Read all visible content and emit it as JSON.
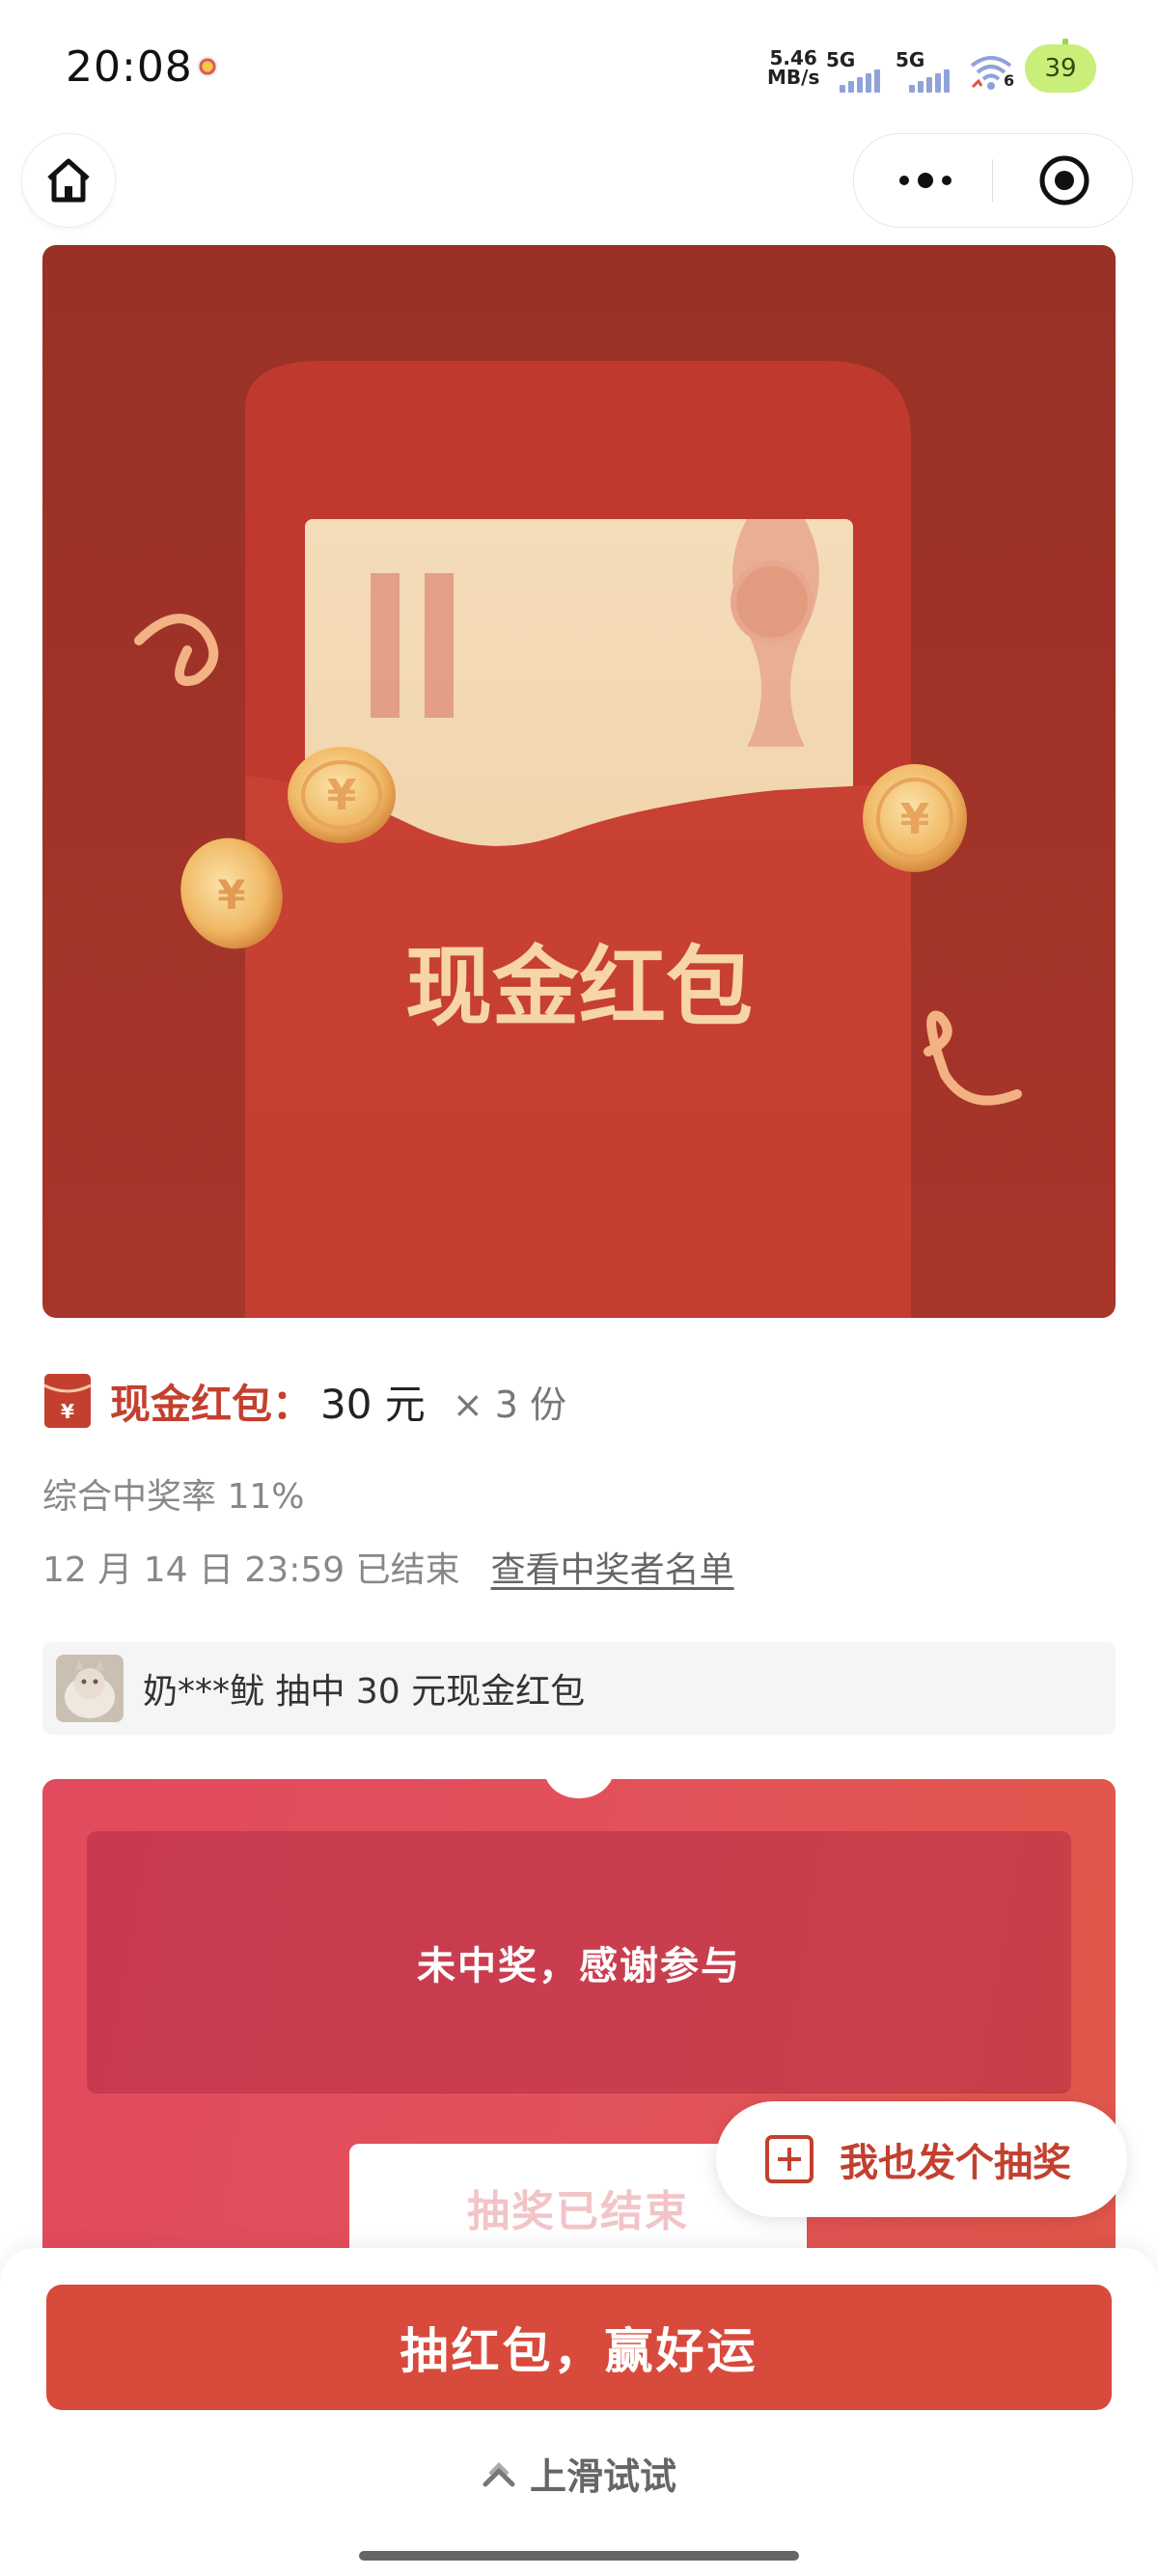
{
  "status_bar": {
    "time": "20:08",
    "net_speed_value": "5.46",
    "net_speed_unit": "MB/s",
    "sim1_label": "5G",
    "sim2_label": "5G",
    "wifi_number": "6",
    "battery": "39"
  },
  "icons": {
    "home": "home-icon",
    "more": "more-dots-icon",
    "close": "target-close-icon",
    "prize": "red-envelope-yuan-icon",
    "add": "plus-square-icon",
    "swipe": "chevron-up-icon"
  },
  "banner": {
    "title": "现金红包"
  },
  "prize": {
    "name": "现金红包：",
    "amount": "30 元",
    "count": "× 3 份"
  },
  "win_rate": "综合中奖率 11%",
  "end_info": {
    "time": "12 月 14 日 23:59 已结束",
    "winners_link": "查看中奖者名单"
  },
  "ticker": {
    "text": "奶***鱿 抽中 30 元现金红包"
  },
  "result": {
    "message": "未中奖，感谢参与",
    "ended_label": "抽奖已结束"
  },
  "create_button": {
    "label": "我也发个抽奖"
  },
  "bottom": {
    "draw_label": "抽红包，赢好运",
    "swipe_hint": "上滑试试"
  },
  "colors": {
    "accent_red": "#d84a3c",
    "text_red": "#c3402f",
    "banner_bg": "#a8352a",
    "battery_green": "#c9ef7a"
  }
}
